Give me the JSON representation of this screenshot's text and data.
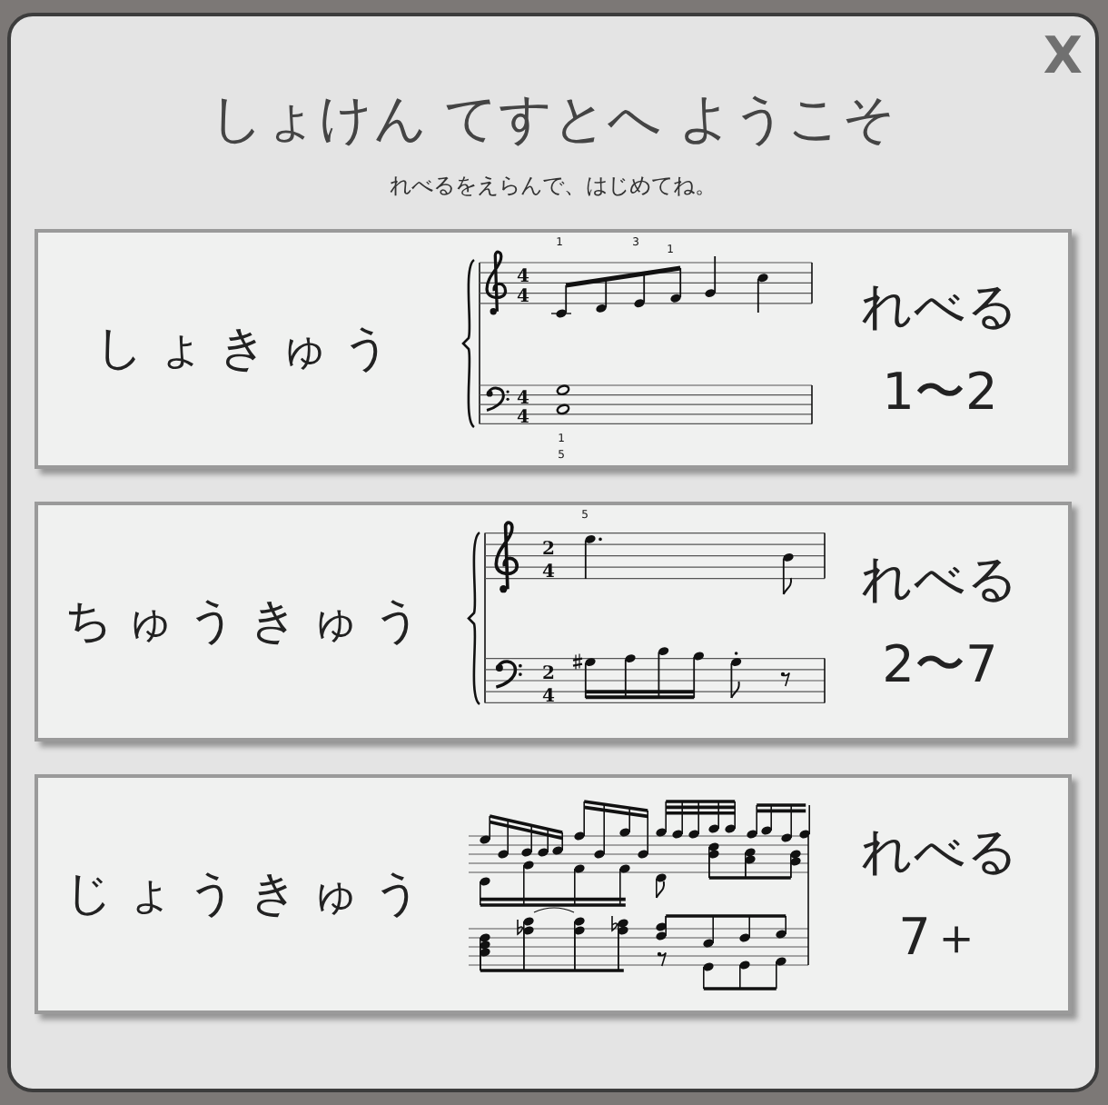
{
  "dialog": {
    "close_label": "X",
    "title": "しょけん てすとへ ようこそ",
    "subtitle": "れべるをえらんで、はじめてね。"
  },
  "levels": [
    {
      "name": "しょきゅう",
      "level_label": "れべる",
      "level_range": "1〜2",
      "score": {
        "kind": "beginner",
        "staves": [
          {
            "kind": "treble",
            "time_signature": [
              "4",
              "4"
            ]
          },
          {
            "kind": "bass",
            "time_signature": [
              "4",
              "4"
            ]
          }
        ],
        "fingerings": [
          "1",
          "3",
          "1",
          "1",
          "5"
        ]
      }
    },
    {
      "name": "ちゅうきゅう",
      "level_label": "れべる",
      "level_range": "2〜7",
      "score": {
        "kind": "intermediate",
        "staves": [
          {
            "kind": "treble",
            "time_signature": [
              "2",
              "4"
            ]
          },
          {
            "kind": "bass",
            "time_signature": [
              "2",
              "4"
            ]
          }
        ],
        "fingerings": [
          "5"
        ]
      }
    },
    {
      "name": "じょうきゅう",
      "level_label": "れべる",
      "level_range": "7＋",
      "score": {
        "kind": "advanced"
      }
    }
  ]
}
